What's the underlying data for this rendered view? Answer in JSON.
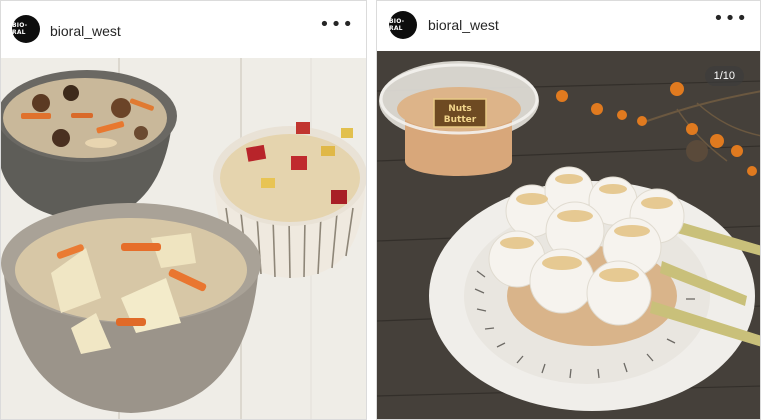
{
  "posts": [
    {
      "username": "bioral_west",
      "avatar_text": "BIO-RAL",
      "more_icon": "more-horizontal-icon",
      "image_alt": "Three bowls of mixed rice with vegetables"
    },
    {
      "username": "bioral_west",
      "avatar_text": "BIO-RAL",
      "more_icon": "more-horizontal-icon",
      "pager": "1/10",
      "jar_label_line1": "Nuts",
      "jar_label_line2": "Butter",
      "image_alt": "Skewered rice dumplings with nut butter on a white plate"
    }
  ]
}
